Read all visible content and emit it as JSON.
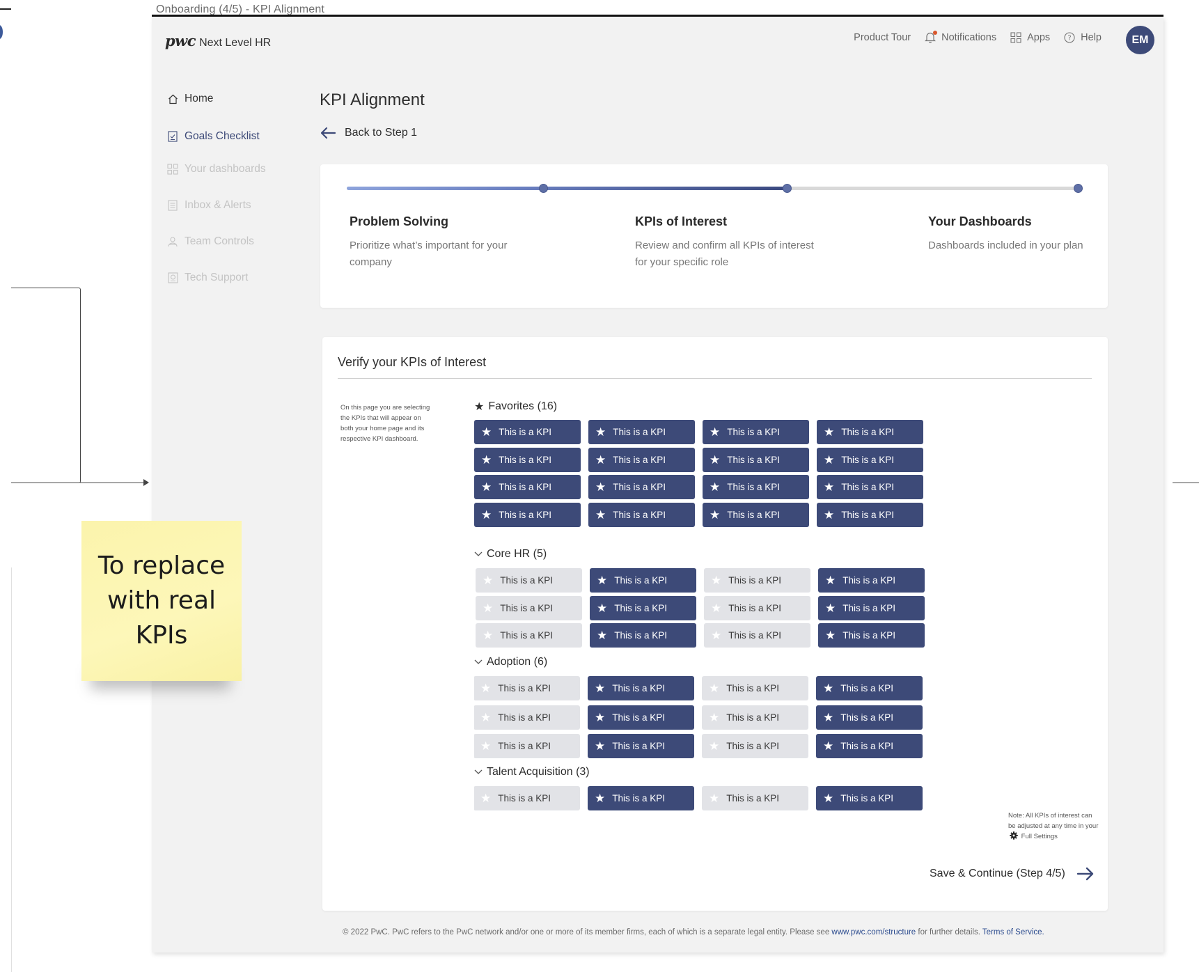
{
  "frame": {
    "title": "Onboarding (4/5) - KPI Alignment"
  },
  "sticky_note": {
    "text": "To replace with real KPIs"
  },
  "header": {
    "logo_mark": "pwc",
    "app_name": "Next Level HR",
    "nav": [
      {
        "label": "Product Tour",
        "icon": "none"
      },
      {
        "label": "Notifications",
        "icon": "bell-icon"
      },
      {
        "label": "Apps",
        "icon": "grid-icon"
      },
      {
        "label": "Help",
        "icon": "help-icon"
      }
    ],
    "avatar_initials": "EM"
  },
  "sidebar": {
    "items": [
      {
        "label": "Home",
        "icon": "home-icon",
        "state": "normal"
      },
      {
        "label": "Goals Checklist",
        "icon": "checklist-icon",
        "state": "active"
      },
      {
        "label": "Your dashboards",
        "icon": "dashboard-icon",
        "state": "disabled"
      },
      {
        "label": "Inbox & Alerts",
        "icon": "inbox-icon",
        "state": "disabled"
      },
      {
        "label": "Team Controls",
        "icon": "team-icon",
        "state": "disabled"
      },
      {
        "label": "Tech Support",
        "icon": "support-icon",
        "state": "disabled"
      }
    ]
  },
  "main": {
    "title": "KPI Alignment",
    "back_label": "Back to Step 1",
    "progress": {
      "fill_fraction": 0.6,
      "steps": [
        {
          "title": "Problem Solving",
          "desc": "Prioritize what’s important for your company"
        },
        {
          "title": "KPIs of Interest",
          "desc": "Review and confirm all KPIs of interest for your specific role"
        },
        {
          "title": "Your Dashboards",
          "desc": "Dashboards included in your plan"
        }
      ]
    },
    "kpi_section": {
      "title": "Verify your KPIs of Interest",
      "helper_text": "On this page you are selecting the KPIs that will appear on both your home page and its respective KPI dashboard.",
      "groups": [
        {
          "label": "Favorites (16)",
          "icon": "star-icon",
          "rows": [
            [
              1,
              1,
              1,
              1
            ],
            [
              1,
              1,
              1,
              1
            ],
            [
              1,
              1,
              1,
              1
            ],
            [
              1,
              1,
              1,
              1
            ]
          ]
        },
        {
          "label": "Core HR (5)",
          "icon": "chevron-down-icon",
          "rows": [
            [
              0,
              1,
              0,
              1
            ],
            [
              0,
              1,
              0,
              1
            ],
            [
              0,
              1,
              0,
              1
            ]
          ]
        },
        {
          "label": "Adoption (6)",
          "icon": "chevron-down-icon",
          "rows": [
            [
              0,
              1,
              0,
              1
            ],
            [
              0,
              1,
              0,
              1
            ],
            [
              0,
              1,
              0,
              1
            ]
          ]
        },
        {
          "label": "Talent Acquisition (3)",
          "icon": "chevron-down-icon",
          "rows": [
            [
              0,
              1,
              0,
              1
            ]
          ]
        }
      ],
      "kpi_label": "This is a KPI",
      "note_line1": "Note: All KPIs of interest can be adjusted at any time in your",
      "note_line2": "Full Settings",
      "save_label": "Save & Continue (Step 4/5)"
    }
  },
  "footer": {
    "text": "© 2022 PwC. PwC refers to the PwC network and/or one or more of its member firms, each of which is a separate legal entity. Please see",
    "link1": "www.pwc.com/structure",
    "mid": "for further details.",
    "link2": "Terms of Service."
  },
  "colors": {
    "accent": "#3d4a78",
    "chip_off": "#e2e3e7",
    "sticky": "#fdf7b9",
    "notification_dot": "#d9562c"
  }
}
